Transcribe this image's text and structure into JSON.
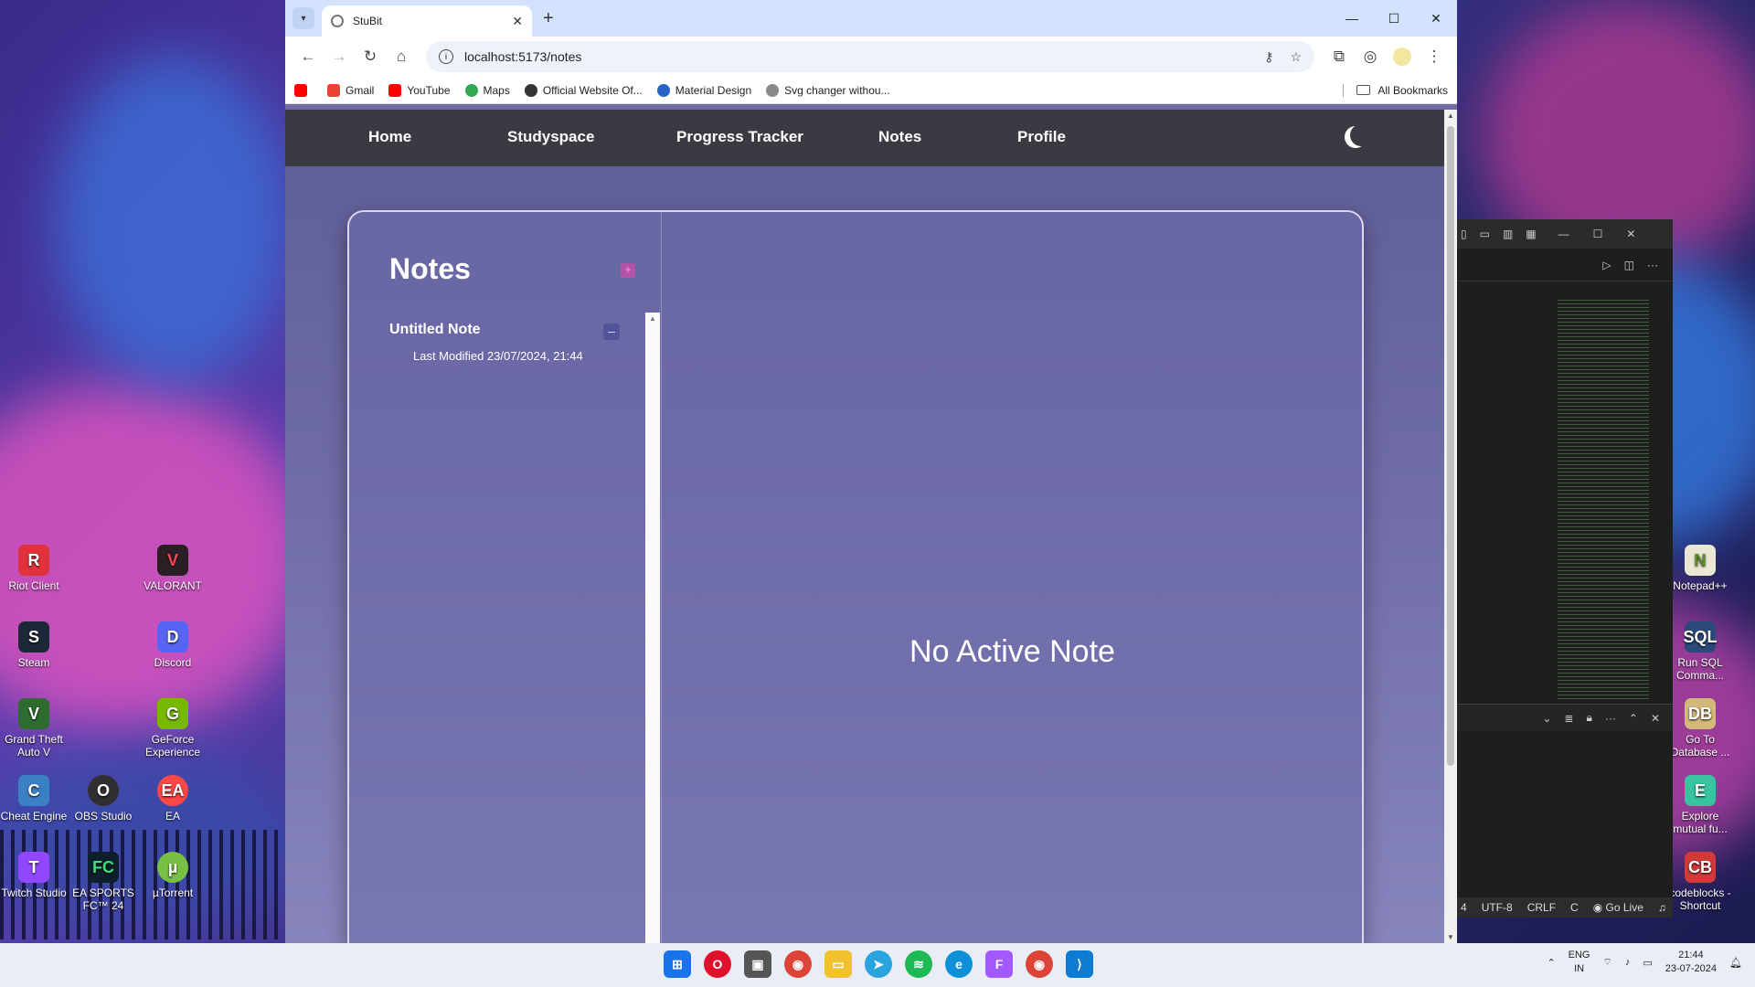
{
  "browser": {
    "tab_title": "StuBit",
    "url": "localhost:5173/notes",
    "bookmarks": [
      "Gmail",
      "YouTube",
      "Maps",
      "Official Website Of...",
      "Material Design",
      "Svg changer withou..."
    ],
    "all_bookmarks": "All Bookmarks"
  },
  "nav": {
    "home": "Home",
    "studyspace": "Studyspace",
    "progress": "Progress Tracker",
    "notes": "Notes",
    "profile": "Profile"
  },
  "notes_page": {
    "title": "Notes",
    "add_symbol": "+",
    "note": {
      "title": "Untitled Note",
      "last_modified": "Last Modified 23/07/2024, 21:44",
      "delete_symbol": "–"
    },
    "empty_message": "No Active Note"
  },
  "desktop_icons": {
    "riot": "Riot Client",
    "valorant": "VALORANT",
    "steam": "Steam",
    "discord": "Discord",
    "gta": "Grand Theft Auto V",
    "geforce": "GeForce Experience",
    "cheat": "Cheat Engine",
    "obs": "OBS Studio",
    "ea": "EA",
    "twitch": "Twitch Studio",
    "fc24": "EA SPORTS FC™ 24",
    "utorrent": "µTorrent",
    "notepad": "Notepad++",
    "runsql": "Run SQL Comma...",
    "gotodb": "Go To Database ...",
    "explore": "Explore mutual fu...",
    "codeblocks": "codeblocks - Shortcut"
  },
  "vscode": {
    "status": {
      "encoding": "UTF-8",
      "eol": "CRLF",
      "lang": "C",
      "golive": "Go Live",
      "prefix": "4"
    }
  },
  "taskbar": {
    "lang_top": "ENG",
    "lang_bottom": "IN",
    "time": "21:44",
    "date": "23-07-2024"
  }
}
